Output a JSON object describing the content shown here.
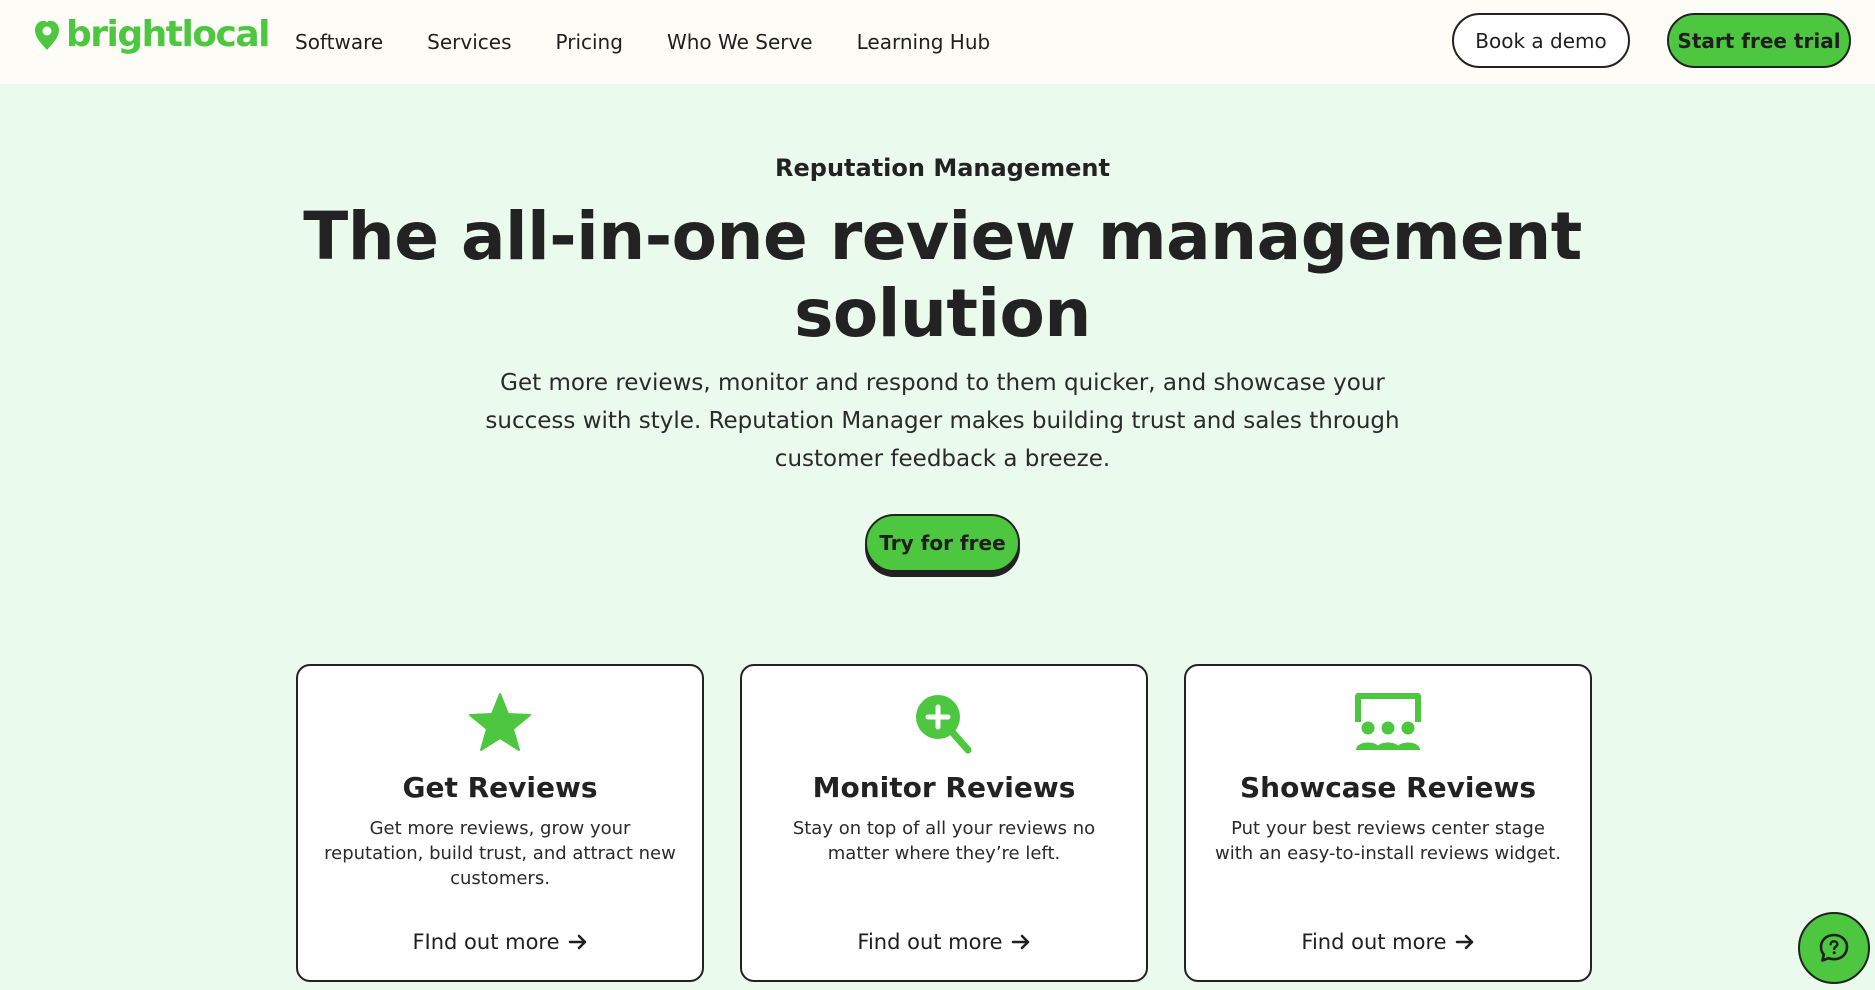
{
  "header": {
    "logo_text": "brightlocal",
    "nav": [
      "Software",
      "Services",
      "Pricing",
      "Who We Serve",
      "Learning Hub"
    ],
    "book_demo": "Book a demo",
    "start_trial": "Start free trial"
  },
  "hero": {
    "eyebrow": "Reputation Management",
    "headline": "The all-in-one review management solution",
    "subtext": "Get more reviews, monitor and respond to them quicker, and showcase your success with style. Reputation Manager makes building trust and sales through customer feedback a breeze.",
    "cta": "Try for free"
  },
  "cards": [
    {
      "icon": "star-icon",
      "title": "Get Reviews",
      "desc": "Get more reviews, grow your reputation, build trust, and attract new customers.",
      "link": "FInd out more"
    },
    {
      "icon": "magnify-plus-icon",
      "title": "Monitor Reviews",
      "desc": "Stay on top of all your reviews no matter where they’re left.",
      "link": "Find out more"
    },
    {
      "icon": "audience-board-icon",
      "title": "Showcase Reviews",
      "desc": "Put your best reviews center stage with an easy-to-install reviews widget.",
      "link": "Find out more"
    }
  ],
  "colors": {
    "brand_green": "#4cc73f",
    "page_bg": "#eafaec",
    "header_bg": "#fdfcf7",
    "ink": "#222222"
  }
}
